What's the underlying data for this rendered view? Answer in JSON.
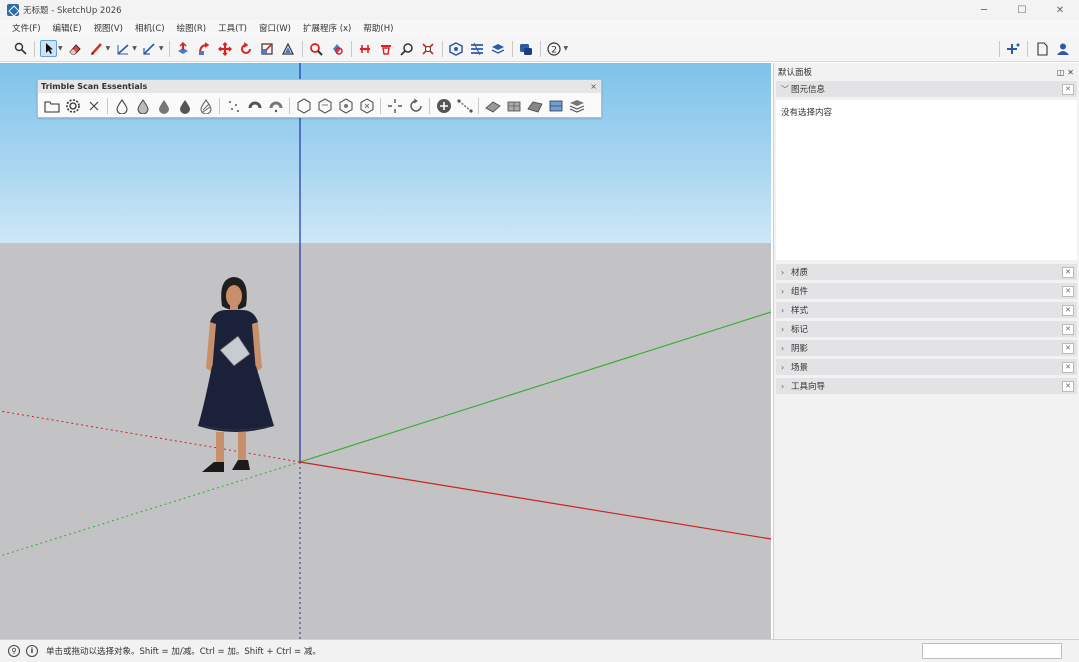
{
  "window": {
    "title": "无标题 - SketchUp 2026"
  },
  "menu": [
    "文件(F)",
    "编辑(E)",
    "视图(V)",
    "相机(C)",
    "绘图(R)",
    "工具(T)",
    "窗口(W)",
    "扩展程序 (x)",
    "帮助(H)"
  ],
  "toolbar_icons": [
    "search-icon",
    "select-icon",
    "eraser-icon",
    "pencil-icon",
    "line-icon",
    "arc-icon",
    "pushpull-icon",
    "followme-icon",
    "move-icon",
    "rotate-icon",
    "scale-icon",
    "offset-icon",
    "orbit-icon",
    "pan-icon",
    "section-icon",
    "section-fill-icon",
    "zoom-icon",
    "zoom-extents-icon",
    "components-icon",
    "materials-icon",
    "layers-icon",
    "styles-icon",
    "instructor-icon",
    "help-icon"
  ],
  "scan_toolbar": {
    "title": "Trimble Scan Essentials",
    "close": "×"
  },
  "tray": {
    "title": "默认面板",
    "entity_info": {
      "label": "图元信息",
      "empty_text": "没有选择内容"
    },
    "panels": [
      "材质",
      "组件",
      "样式",
      "标记",
      "阴影",
      "场景",
      "工具向导"
    ]
  },
  "status": {
    "text": "单击或拖动以选择对象。Shift = 加/减。Ctrl = 加。Shift + Ctrl = 减。"
  },
  "colors": {
    "sky_top": "#7ec3ea",
    "ground": "#c3c3c5",
    "axis_red": "#cc2222",
    "axis_green": "#33aa33",
    "axis_blue": "#2233aa",
    "accent": "#2b6cb0"
  }
}
